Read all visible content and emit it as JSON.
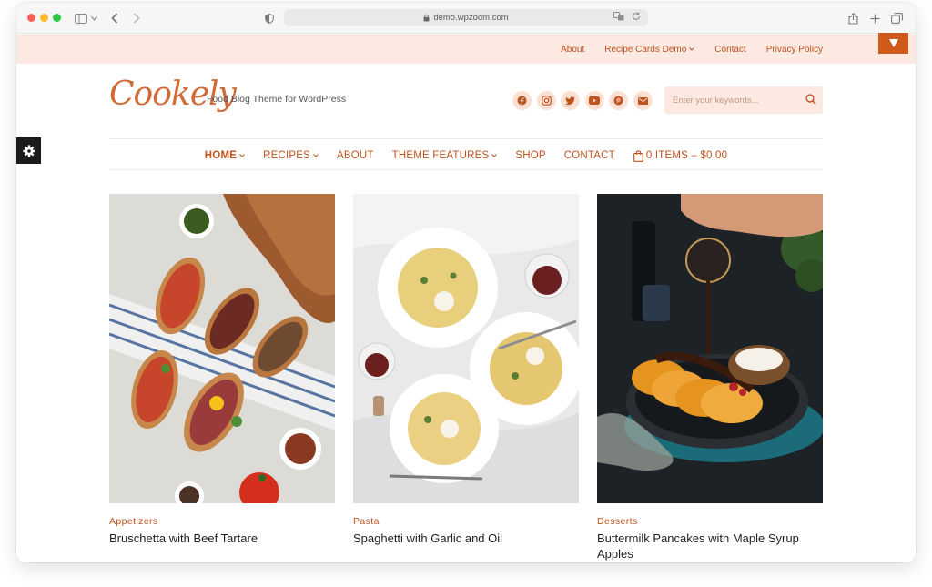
{
  "browser": {
    "url": "demo.wpzoom.com"
  },
  "topbar": {
    "items": [
      {
        "label": "About"
      },
      {
        "label": "Recipe Cards Demo",
        "has_dropdown": true
      },
      {
        "label": "Contact"
      },
      {
        "label": "Privacy Policy"
      }
    ]
  },
  "header": {
    "logo": "Cookely",
    "tagline": "Food Blog Theme for WordPress",
    "social_icons": [
      "facebook-icon",
      "instagram-icon",
      "twitter-icon",
      "youtube-icon",
      "pinterest-icon",
      "email-icon"
    ],
    "search_placeholder": "Enter your keywords..."
  },
  "nav": {
    "items": [
      {
        "label": "HOME",
        "has_dropdown": true,
        "active": true
      },
      {
        "label": "RECIPES",
        "has_dropdown": true
      },
      {
        "label": "ABOUT"
      },
      {
        "label": "THEME FEATURES",
        "has_dropdown": true
      },
      {
        "label": "SHOP"
      },
      {
        "label": "CONTACT"
      }
    ],
    "cart_label": "0 ITEMS – $0.00"
  },
  "posts": [
    {
      "category": "Appetizers",
      "title": "Bruschetta with Beef Tartare"
    },
    {
      "category": "Pasta",
      "title": "Spaghetti with Garlic and Oil"
    },
    {
      "category": "Desserts",
      "title": "Buttermilk Pancakes with Maple Syrup Apples"
    }
  ],
  "colors": {
    "accent": "#c0521e",
    "topbar_bg": "#fbe9e2",
    "logo": "#d06a37",
    "dark": "#1b1b1b"
  }
}
